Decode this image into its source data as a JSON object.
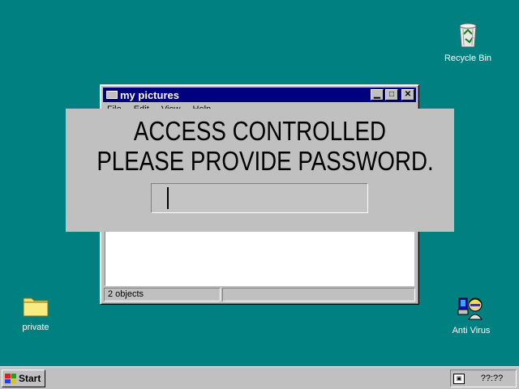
{
  "desktop": {
    "background_color": "#008080",
    "icons": [
      {
        "label": "Recycle Bin",
        "icon": "recycle-bin-icon"
      },
      {
        "label": "private",
        "icon": "folder-icon"
      },
      {
        "label": "Anti Virus",
        "icon": "anti-virus-icon"
      }
    ]
  },
  "window": {
    "title": "my pictures",
    "title_color": "#000080",
    "menu": [
      "File",
      "Edit",
      "View",
      "Help"
    ],
    "status_objects": "2 objects",
    "status_second": ""
  },
  "access_dialog": {
    "line1": "ACCESS CONTROLLED",
    "line2": "PLEASE PROVIDE PASSWORD.",
    "password_value": ""
  },
  "taskbar": {
    "start_label": "Start",
    "clock": "??:??"
  }
}
